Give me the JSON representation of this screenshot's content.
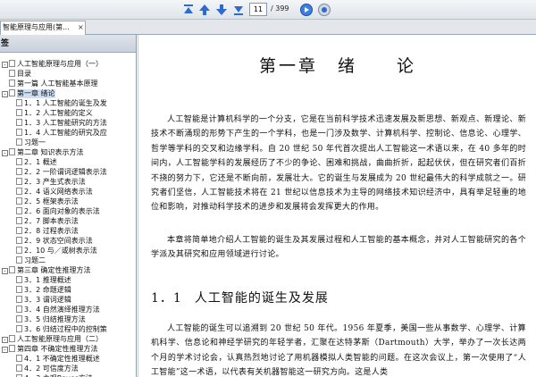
{
  "toolbar": {
    "page_current": "11",
    "page_total": "/ 399"
  },
  "tab": {
    "title": "智能原理与应用(第...",
    "close": "×"
  },
  "bookmarks": {
    "header": "签",
    "items": [
      {
        "exp": "-",
        "label": "人工智能原理与应用（一）"
      },
      {
        "exp": "",
        "label": "目录"
      },
      {
        "exp": "",
        "label": "第一篇 人工智能基本原理"
      },
      {
        "exp": "-",
        "label": "第一章 绪论"
      },
      {
        "exp": "",
        "label": "1．1 人工智能的诞生及发"
      },
      {
        "exp": "",
        "label": "1．2 人工智能的定义"
      },
      {
        "exp": "",
        "label": "1．3 人工智能研究的方法"
      },
      {
        "exp": "",
        "label": "1．4 人工智能的研究及应"
      },
      {
        "exp": "",
        "label": "习题一"
      },
      {
        "exp": "-",
        "label": "第二章 知识表示方法"
      },
      {
        "exp": "",
        "label": "2．1 概述"
      },
      {
        "exp": "",
        "label": "2．2 一阶谓词逻辑表示法"
      },
      {
        "exp": "",
        "label": "2．3 产生式表示法"
      },
      {
        "exp": "",
        "label": "2．4 语义网络表示法"
      },
      {
        "exp": "",
        "label": "2．5 框架表示法"
      },
      {
        "exp": "",
        "label": "2．6 面向对象的表示法"
      },
      {
        "exp": "",
        "label": "2．7 脚本表示法"
      },
      {
        "exp": "",
        "label": "2．8 过程表示法"
      },
      {
        "exp": "",
        "label": "2．9 状态空间表示法"
      },
      {
        "exp": "",
        "label": "2．10 与／或树表示法"
      },
      {
        "exp": "",
        "label": "习题二"
      },
      {
        "exp": "-",
        "label": "第三章 确定性推理方法"
      },
      {
        "exp": "",
        "label": "3．1 推理概述"
      },
      {
        "exp": "",
        "label": "3．2 命题逻辑"
      },
      {
        "exp": "",
        "label": "3．3 谓词逻辑"
      },
      {
        "exp": "",
        "label": "3．4 自然演绎推理方法"
      },
      {
        "exp": "",
        "label": "3．5 归结推理方法"
      },
      {
        "exp": "",
        "label": "3．6 归结过程中的控制策"
      },
      {
        "exp": "-",
        "label": "人工智能原理与应用（二）"
      },
      {
        "exp": "-",
        "label": "第四章 不确定性推理方法"
      },
      {
        "exp": "",
        "label": "4．1 不确定性推理概述"
      },
      {
        "exp": "",
        "label": "4．2 可信度方法"
      },
      {
        "exp": "",
        "label": "4．3 主观Bayes方法"
      }
    ]
  },
  "document": {
    "chapter_title": "第一章　绪　　论",
    "para1": "人工智能是计算机科学的一个分支，它是在当前科学技术迅速发展及新思想、新观点、新理论、新技术不断涌现的形势下产生的一个学科，也是一门涉及数学、计算机科学、控制论、信息论、心理学、哲学等学科的交叉和边缘学科。自 20 世纪 50 年代首次提出人工智能这一术语以来，在 40 多年的时间内，人工智能学科的发展经历了不少的争论、困难和挑战，曲曲折折，起起伏伏，但在研究者们百折不挠的努力下，它还是不断向前，发展壮大。它的诞生与发展成为 20 世纪最伟大的科学成就之一。研究者们坚信，人工智能技术将在 21 世纪以信息技术为主导的网络技术知识经济中，具有举足轻重的地位和影响，对推动科学技术的进步和发展将会发挥更大的作用。",
    "para2": "本章将简单地介绍人工智能的诞生及其发展过程和人工智能的基本概念，并对人工智能研究的各个学派及其研究和应用领域进行讨论。",
    "section_number": "1．1",
    "section_title": "人工智能的诞生及发展",
    "para3": "人工智能的诞生可以追溯到 20 世纪 50 年代。1956 年夏季，美国一些从事数学、心理学、计算机科学、信息论和神经学研究的年轻学者，汇聚在达特茅斯（Dartmouth）大学，举办了一次长达两个月的学术讨论会，认真热烈地讨论了用机器模拟人类智能的问题。在这次会议上，第一次使用了“人工智能”这一术语，以代表有关机器智能这一研究方向。这是人类"
  },
  "icons": {
    "first": "first-page-icon",
    "prev": "prev-page-icon",
    "next": "next-page-icon",
    "last": "last-page-icon",
    "go": "go-icon",
    "stop": "stop-icon"
  }
}
